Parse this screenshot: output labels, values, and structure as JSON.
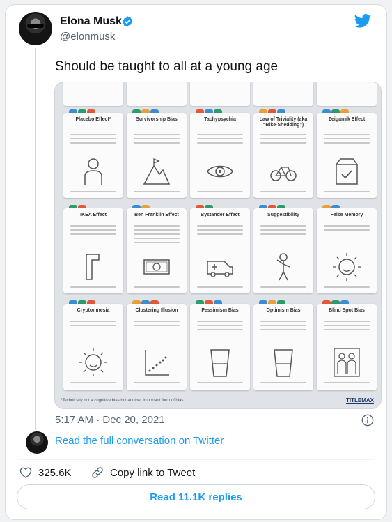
{
  "author": {
    "name": "Elona Musk",
    "handle": "@elonmusk",
    "verified_icon": "verified-badge-icon"
  },
  "tweet": {
    "text": "Should be taught to all at a young age",
    "timestamp": "5:17 AM · Dec 20, 2021"
  },
  "media": {
    "description_rows": [
      {
        "cards": [
          {
            "title": "Placebo Effect*",
            "icon": "person-icon"
          },
          {
            "title": "Survivorship Bias",
            "icon": "mountain-icon"
          },
          {
            "title": "Tachypsychia",
            "icon": "eye-icon"
          },
          {
            "title": "Law of Triviality (aka “Bike-Shedding”)",
            "icon": "bicycle-icon"
          },
          {
            "title": "Zeigarnik Effect",
            "icon": "box-icon"
          }
        ]
      },
      {
        "cards": [
          {
            "title": "IKEA Effect",
            "icon": "hex-key-icon"
          },
          {
            "title": "Ben Franklin Effect",
            "icon": "money-icon"
          },
          {
            "title": "Bystander Effect",
            "icon": "ambulance-icon"
          },
          {
            "title": "Suggestibility",
            "icon": "child-icon"
          },
          {
            "title": "False Memory",
            "icon": "sun-face-icon"
          }
        ]
      },
      {
        "cards": [
          {
            "title": "Cryptomnesia",
            "icon": "sun-face-icon"
          },
          {
            "title": "Clustering Illusion",
            "icon": "scatter-icon"
          },
          {
            "title": "Pessimism Bias",
            "icon": "glass-icon"
          },
          {
            "title": "Optimism Bias",
            "icon": "glass-icon"
          },
          {
            "title": "Blind Spot Bias",
            "icon": "people-icon"
          }
        ]
      }
    ],
    "footnote": "*Technically not a cognitive bias but another important form of bias",
    "logo": "TITLEMAX"
  },
  "thread": {
    "link_label": "Read the full conversation on Twitter"
  },
  "actions": {
    "likes": "325.6K",
    "copy_label": "Copy link to Tweet",
    "replies_button": "Read 11.1K replies"
  },
  "colors": {
    "accent": "#1d9bf0",
    "dot_colors": [
      "#3b8fd1",
      "#2e9b6c",
      "#e05a3a",
      "#e8a13a"
    ]
  }
}
